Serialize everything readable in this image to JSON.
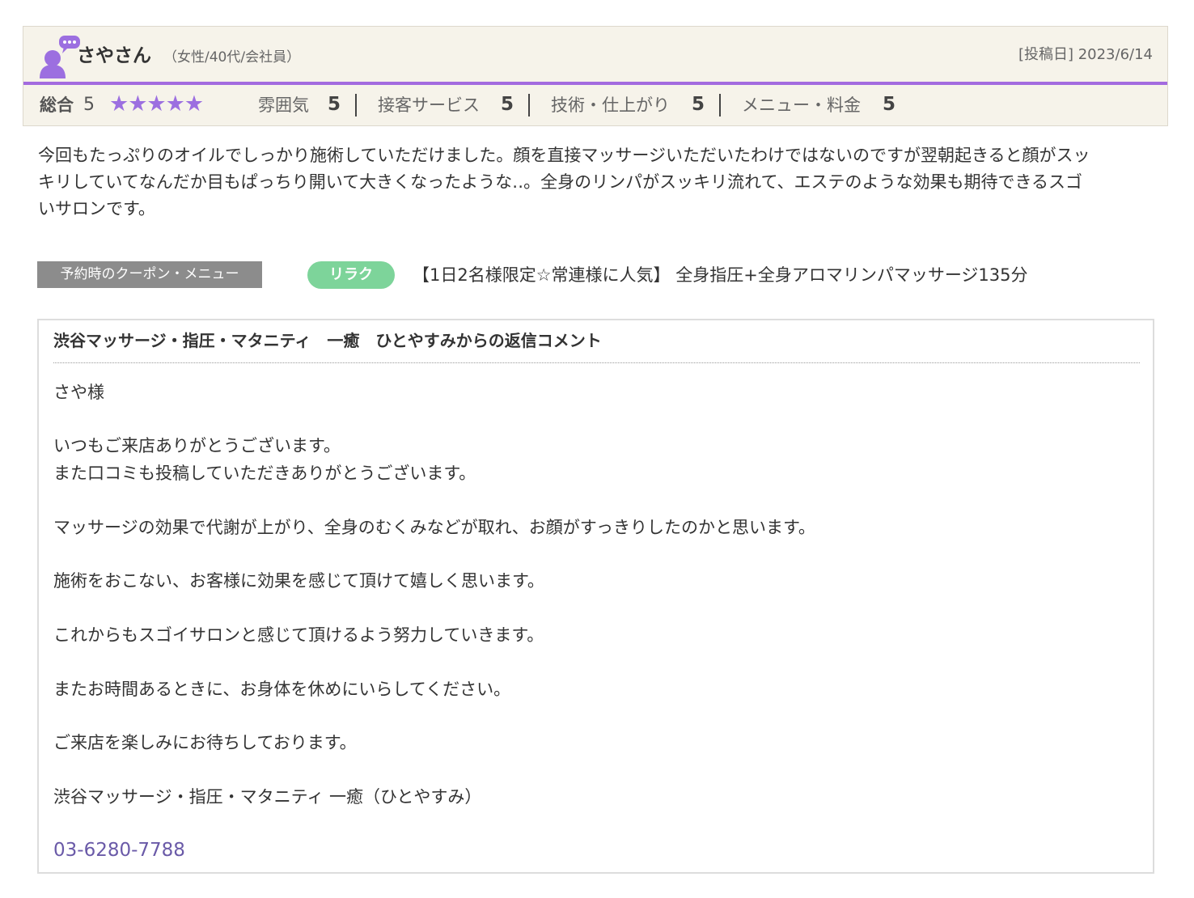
{
  "review": {
    "user_name": "さやさん",
    "user_attributes": "（女性/40代/会社員）",
    "post_date": "[投稿日] 2023/6/14",
    "total_label": "総合",
    "total_score": "5",
    "stars": "★★★★★",
    "star_rating": 5,
    "star_color": "#9c6fe0",
    "accent_color": "#a36bdf",
    "categories": [
      {
        "label": "雰囲気",
        "score": "5"
      },
      {
        "label": "接客サービス",
        "score": "5"
      },
      {
        "label": "技術・仕上がり",
        "score": "5"
      },
      {
        "label": "メニュー・料金",
        "score": "5"
      }
    ],
    "body_lines": [
      "今回もたっぷりのオイルでしっかり施術していただけました。顔を直接マッサージいただいたわけではないのですが翌朝起きると顔がスッ",
      "キリしていてなんだか目もぱっちり開いて大きくなったような‥。全身のリンパがスッキリ流れて、エステのような効果も期待できるスゴ",
      "いサロンです。"
    ]
  },
  "coupon": {
    "label": "予約時のクーポン・メニュー",
    "tag": "リラク",
    "tag_color": "#7dd49a",
    "text": "【1日2名様限定☆常連様に人気】 全身指圧+全身アロマリンパマッサージ135分"
  },
  "reply": {
    "title": "渋谷マッサージ・指圧・マタニティ　一癒　ひとやすみからの返信コメント",
    "lines": [
      "さや様",
      "いつもご来店ありがとうございます。",
      "また口コミも投稿していただきありがとうございます。",
      "マッサージの効果で代謝が上がり、全身のむくみなどが取れ、お顔がすっきりしたのかと思います。",
      "施術をおこない、お客様に効果を感じて頂けて嬉しく思います。",
      "これからもスゴイサロンと感じて頂けるよう努力していきます。",
      "またお時間あるときに、お身体を休めにいらしてください。",
      "ご来店を楽しみにお待ちしております。",
      "渋谷マッサージ・指圧・マタニティ 一癒（ひとやすみ）"
    ],
    "phone": "03-6280-7788",
    "phone_color": "#6a5aa8"
  }
}
